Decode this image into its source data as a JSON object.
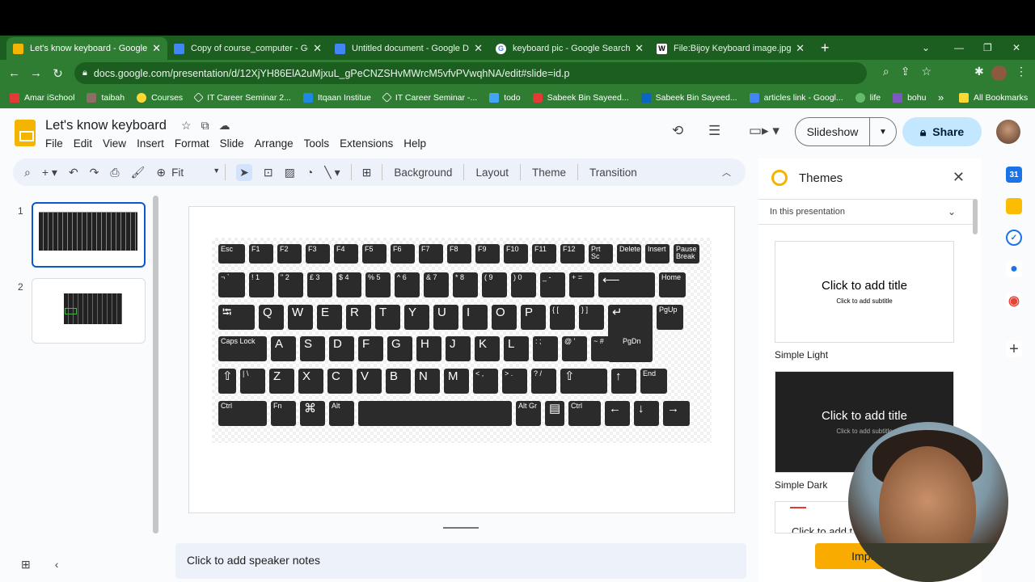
{
  "browser": {
    "tabs": [
      {
        "title": "Let's know keyboard - Google Sli",
        "icon": "slides-favicon",
        "color": "#f4b400",
        "active": true
      },
      {
        "title": "Copy of course_computer - Goo",
        "icon": "docs-favicon",
        "color": "#4285f4"
      },
      {
        "title": "Untitled document - Google Doc",
        "icon": "docs-favicon",
        "color": "#4285f4"
      },
      {
        "title": "keyboard pic - Google Search",
        "icon": "google-favicon",
        "color": "#ffffff"
      },
      {
        "title": "File:Bijoy Keyboard image.jpg - S",
        "icon": "wikipedia-favicon",
        "color": "#ffffff"
      }
    ],
    "url": "docs.google.com/presentation/d/12XjYH86ElA2uMjxuL_gPeCNZSHvMWrcM5vfvPVwqhNA/edit#slide=id.p",
    "bookmarks": [
      {
        "label": "Amar iSchool",
        "color": "#e53935"
      },
      {
        "label": "taibah",
        "color": "#8d6e63"
      },
      {
        "label": "Courses",
        "color": "#fdd835"
      },
      {
        "label": "IT Career Seminar 2...",
        "color": "#9e9e9e"
      },
      {
        "label": "Itqaan Institue",
        "color": "#1e88e5"
      },
      {
        "label": "IT Career Seminar -...",
        "color": "#9e9e9e"
      },
      {
        "label": "todo",
        "color": "#42a5f5"
      },
      {
        "label": "Sabeek Bin Sayeed...",
        "color": "#e53935"
      },
      {
        "label": "Sabeek Bin Sayeed...",
        "color": "#0a66c2"
      },
      {
        "label": "articles link - Googl...",
        "color": "#4285f4"
      },
      {
        "label": "life",
        "color": "#66bb6a"
      },
      {
        "label": "bohu",
        "color": "#7e57c2"
      }
    ],
    "bookmarks_overflow": "»",
    "all_bookmarks": "All Bookmarks"
  },
  "doc": {
    "title": "Let's know keyboard",
    "menu": [
      "File",
      "Edit",
      "View",
      "Insert",
      "Format",
      "Slide",
      "Arrange",
      "Tools",
      "Extensions",
      "Help"
    ],
    "slideshow_label": "Slideshow",
    "share_label": "Share"
  },
  "toolbar": {
    "zoom": "Fit",
    "background": "Background",
    "layout": "Layout",
    "theme": "Theme",
    "transition": "Transition"
  },
  "filmstrip": {
    "slides": [
      "1",
      "2"
    ]
  },
  "notes_placeholder": "Click to add speaker notes",
  "keyboard": {
    "rows": [
      [
        "Esc",
        "F1",
        "F2",
        "F3",
        "F4",
        "F5",
        "F6",
        "F7",
        "F8",
        "F9",
        "F10",
        "F11",
        "F12",
        "Prt Sc",
        "Delete",
        "Insert",
        "Pause Break"
      ],
      [
        "¬ `",
        "! 1",
        "\" 2",
        "£ 3",
        "$ 4",
        "% 5",
        "^ 6",
        "& 7",
        "* 8",
        "( 9",
        ") 0",
        "_ -",
        "+ =",
        "⟵",
        "Home"
      ],
      [
        "⭾",
        "Q",
        "W",
        "E",
        "R",
        "T",
        "Y",
        "U",
        "I",
        "O",
        "P",
        "{ [",
        "} ]",
        "↵",
        "PgUp"
      ],
      [
        "Caps Lock",
        "A",
        "S",
        "D",
        "F",
        "G",
        "H",
        "J",
        "K",
        "L",
        ": ;",
        "@ '",
        "~ #",
        "PgDn"
      ],
      [
        "⇧",
        "| \\",
        "Z",
        "X",
        "C",
        "V",
        "B",
        "N",
        "M",
        "< ,",
        "> .",
        "? /",
        "⇧",
        "↑",
        "End"
      ],
      [
        "Ctrl",
        "Fn",
        "⌘",
        "Alt",
        "",
        "Alt Gr",
        "▤",
        "Ctrl",
        "←",
        "↓",
        "→"
      ]
    ]
  },
  "themes": {
    "title": "Themes",
    "filter": "In this presentation",
    "items": [
      {
        "name": "Simple Light",
        "title": "Click to add title",
        "subtitle": "Click to add subtitle",
        "bg": "#ffffff",
        "fg": "#000000"
      },
      {
        "name": "Simple Dark",
        "title": "Click to add title",
        "subtitle": "Click to add subtitle",
        "bg": "#212121",
        "fg": "#ffffff"
      },
      {
        "name": "",
        "title": "Click to add t",
        "subtitle": "",
        "bg": "#ffffff",
        "fg": "#000000"
      }
    ],
    "import_label": "Import"
  }
}
